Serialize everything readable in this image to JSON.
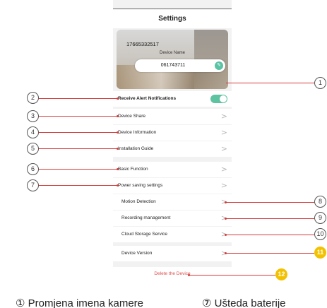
{
  "header": {
    "title": "Settings"
  },
  "device_card": {
    "device_id": "17665332517",
    "name_label": "Device Name",
    "name_value": "061743711",
    "edit_icon": "pencil-icon"
  },
  "rows": {
    "alerts": "Receive Alert Notifications",
    "share": "Device Share",
    "info": "Device Information",
    "install": "Installation Guide",
    "basic": "Basic Function",
    "power": "Power saving settings",
    "motion": "Motion Detection",
    "recording": "Recording management",
    "cloud": "Cloud Storage Service",
    "version": "Device Version",
    "delete": "Delete the Device"
  },
  "toggle": {
    "alerts_on": true
  },
  "chevron_glyph": ">",
  "badges": {
    "b1": "1",
    "b2": "2",
    "b3": "3",
    "b4": "4",
    "b5": "5",
    "b6": "6",
    "b7": "7",
    "b8": "8",
    "b9": "9",
    "b10": "10",
    "b11": "11",
    "b12": "12"
  },
  "captions": {
    "left": "① Promjena imena kamere",
    "right": "⑦ Ušteda baterije"
  },
  "colors": {
    "accent_green": "#5ec3a0",
    "callout_red": "#d43a3a",
    "delete_red": "#e04b4b",
    "badge_yellow": "#f2c200"
  }
}
